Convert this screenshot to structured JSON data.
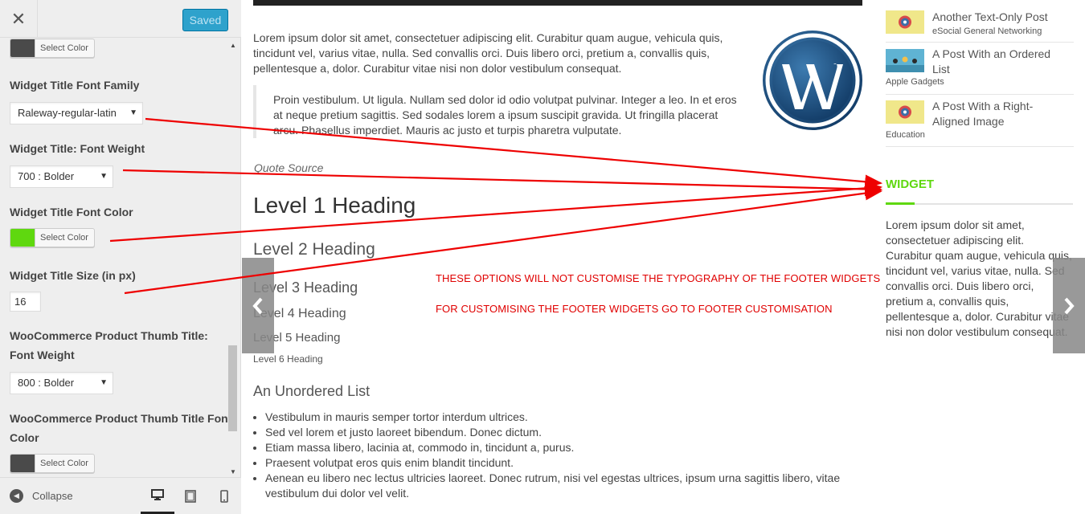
{
  "sidebar": {
    "close_label": "✕",
    "saved_label": "Saved",
    "controls": {
      "color_1": {
        "button_label": "Select Color",
        "color": "#4a4a4a"
      },
      "font_family": {
        "label": "Widget Title Font Family",
        "value": "Raleway-regular-latin"
      },
      "font_weight": {
        "label": "Widget Title: Font Weight",
        "value": "700 : Bolder"
      },
      "font_color": {
        "label": "Widget Title Font Color",
        "button_label": "Select Color",
        "color": "#5fd80f"
      },
      "size": {
        "label": "Widget Title Size (in px)",
        "value": "16"
      },
      "woo_weight": {
        "label_line1": "WooCommerce Product Thumb Title:",
        "label_line2": "Font Weight",
        "value": "800 : Bolder"
      },
      "woo_color": {
        "label_line1": "WooCommerce Product Thumb Title Font",
        "label_line2": "Color",
        "button_label": "Select Color",
        "color": "#4a4a4a"
      }
    },
    "footer": {
      "collapse_label": "Collapse"
    }
  },
  "preview": {
    "intro": "Lorem ipsum dolor sit amet, consectetuer adipiscing elit. Curabitur quam augue, vehicula quis, tincidunt vel, varius vitae, nulla. Sed convallis orci. Duis libero orci, pretium a, convallis quis, pellentesque a, dolor. Curabitur vitae nisi non dolor vestibulum consequat.",
    "quote": "Proin vestibulum. Ut ligula. Nullam sed dolor id odio volutpat pulvinar. Integer a leo. In et eros at neque pretium sagittis. Sed sodales lorem a ipsum suscipit gravida. Ut fringilla placerat arcu. Phasellus imperdiet. Mauris ac justo et turpis pharetra vulputate.",
    "quote_source": "Quote Source",
    "headings": {
      "h1": "Level 1 Heading",
      "h2": "Level 2 Heading",
      "h3": "Level 3 Heading",
      "h4": "Level 4 Heading",
      "h5": "Level 5 Heading",
      "h6": "Level 6 Heading"
    },
    "ul_title": "An Unordered List",
    "ul_items": [
      "Vestibulum in mauris semper tortor interdum ultrices.",
      "Sed vel lorem et justo laoreet bibendum. Donec dictum.",
      "Etiam massa libero, lacinia at, commodo in, tincidunt a, purus.",
      "Praesent volutpat eros quis enim blandit tincidunt.",
      "Aenean eu libero nec lectus ultricies laoreet. Donec rutrum, nisi vel egestas ultrices, ipsum urna sagittis libero, vitae vestibulum dui dolor vel velit."
    ],
    "notice_1": "THESE OPTIONS WILL NOT CUSTOMISE THE TYPOGRAPHY OF THE FOOTER WIDGETS",
    "notice_2": "FOR CUSTOMISING THE FOOTER WIDGETS GO TO FOOTER CUSTOMISATION",
    "posts": [
      {
        "title": "Another Text-Only Post",
        "category": "eSocial General Networking"
      },
      {
        "title": "A Post With an Ordered List",
        "category": "Apple Gadgets"
      },
      {
        "title": "A Post With a Right-Aligned Image",
        "category": "Education"
      }
    ],
    "widget": {
      "title": "WIDGET",
      "title_color": "#5fd80f",
      "text": "Lorem ipsum dolor sit amet, consectetuer adipiscing elit. Curabitur quam augue, vehicula quis, tincidunt vel, varius vitae, nulla. Sed convallis orci. Duis libero orci, pretium a, convallis quis, pellentesque a, dolor. Curabitur vitae nisi non dolor vestibulum consequat."
    }
  }
}
